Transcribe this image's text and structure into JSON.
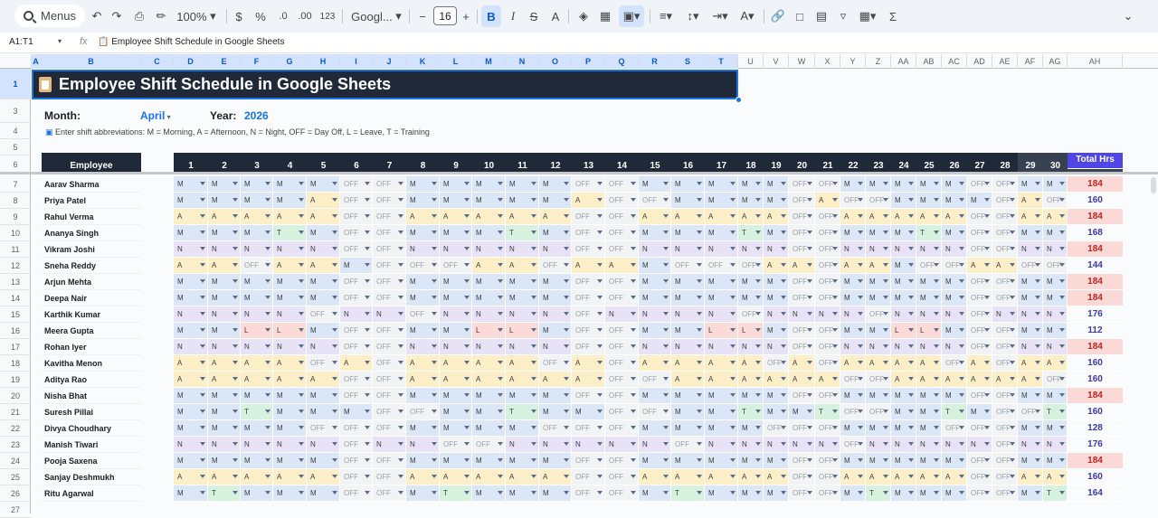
{
  "toolbar": {
    "menus_label": "Menus",
    "zoom": "100%",
    "currency": "$",
    "percent": "%",
    "dec_decrease": ".0",
    "dec_increase": ".00",
    "number_format": "123",
    "font": "Googl...",
    "font_size": "16",
    "bold": "B",
    "italic": "I",
    "strike": "S",
    "text_color": "A"
  },
  "formula_bar": {
    "name_box": "A1:T1",
    "fx": "fx",
    "content": "📋 Employee Shift Schedule in Google Sheets"
  },
  "columns": [
    "A",
    "B",
    "C",
    "D",
    "E",
    "F",
    "G",
    "H",
    "I",
    "J",
    "K",
    "L",
    "M",
    "N",
    "O",
    "P",
    "Q",
    "R",
    "S",
    "T",
    "U",
    "V",
    "W",
    "X",
    "Y",
    "Z",
    "AA",
    "AB",
    "AC",
    "AD",
    "AE",
    "AF",
    "AG",
    "AH"
  ],
  "rows": [
    "1",
    "3",
    "4",
    "5",
    "6",
    "7",
    "8",
    "9",
    "10",
    "11",
    "12",
    "13",
    "14",
    "15",
    "16",
    "17",
    "18",
    "19",
    "20",
    "21",
    "22",
    "23",
    "24",
    "25",
    "26",
    "27"
  ],
  "sheet": {
    "title": "Employee Shift Schedule in Google Sheets",
    "month_label": "Month:",
    "month_value": "April",
    "year_label": "Year:",
    "year_value": "2026",
    "note": "Enter shift abbreviations: M = Morning, A = Afternoon, N = Night, OFF = Day Off, L = Leave, T = Training"
  },
  "table": {
    "employee_header": "Employee",
    "days": [
      "1",
      "2",
      "3",
      "4",
      "5",
      "6",
      "7",
      "8",
      "9",
      "10",
      "11",
      "12",
      "13",
      "14",
      "15",
      "16",
      "17",
      "18",
      "19",
      "20",
      "21",
      "22",
      "23",
      "24",
      "25",
      "26",
      "27",
      "28",
      "29",
      "30",
      "31"
    ],
    "total_header": "Total Hrs",
    "employees": [
      {
        "name": "Aarav Sharma",
        "total": "184",
        "hi": true,
        "shifts": [
          "M",
          "M",
          "M",
          "M",
          "M",
          "OFF",
          "OFF",
          "M",
          "M",
          "M",
          "M",
          "M",
          "OFF",
          "OFF",
          "M",
          "M",
          "M",
          "M",
          "M",
          "OFF",
          "OFF",
          "M",
          "M",
          "M",
          "M",
          "M",
          "OFF",
          "OFF",
          "M",
          "M",
          "M"
        ]
      },
      {
        "name": "Priya Patel",
        "total": "160",
        "hi": false,
        "shifts": [
          "M",
          "M",
          "M",
          "M",
          "A",
          "OFF",
          "OFF",
          "M",
          "M",
          "M",
          "M",
          "M",
          "A",
          "OFF",
          "OFF",
          "M",
          "M",
          "M",
          "M",
          "OFF",
          "A",
          "OFF",
          "OFF",
          "M",
          "M",
          "M",
          "M",
          "OFF",
          "A",
          "OFF",
          "M"
        ]
      },
      {
        "name": "Rahul Verma",
        "total": "184",
        "hi": true,
        "shifts": [
          "A",
          "A",
          "A",
          "A",
          "A",
          "OFF",
          "OFF",
          "A",
          "A",
          "A",
          "A",
          "A",
          "OFF",
          "OFF",
          "A",
          "A",
          "A",
          "A",
          "A",
          "OFF",
          "OFF",
          "A",
          "A",
          "A",
          "A",
          "A",
          "OFF",
          "OFF",
          "A",
          "A",
          "A"
        ]
      },
      {
        "name": "Ananya Singh",
        "total": "168",
        "hi": false,
        "shifts": [
          "M",
          "M",
          "M",
          "T",
          "M",
          "OFF",
          "OFF",
          "M",
          "M",
          "M",
          "T",
          "M",
          "OFF",
          "OFF",
          "M",
          "M",
          "M",
          "T",
          "M",
          "OFF",
          "OFF",
          "M",
          "M",
          "M",
          "T",
          "M",
          "OFF",
          "OFF",
          "M",
          "M",
          "M"
        ]
      },
      {
        "name": "Vikram Joshi",
        "total": "184",
        "hi": true,
        "shifts": [
          "N",
          "N",
          "N",
          "N",
          "N",
          "OFF",
          "OFF",
          "N",
          "N",
          "N",
          "N",
          "N",
          "OFF",
          "OFF",
          "N",
          "N",
          "N",
          "N",
          "N",
          "OFF",
          "OFF",
          "N",
          "N",
          "N",
          "N",
          "N",
          "OFF",
          "OFF",
          "N",
          "N",
          "N"
        ]
      },
      {
        "name": "Sneha Reddy",
        "total": "144",
        "hi": false,
        "shifts": [
          "A",
          "A",
          "OFF",
          "A",
          "A",
          "M",
          "OFF",
          "OFF",
          "OFF",
          "A",
          "A",
          "OFF",
          "A",
          "A",
          "M",
          "OFF",
          "OFF",
          "OFF",
          "A",
          "A",
          "OFF",
          "A",
          "A",
          "M",
          "OFF",
          "OFF",
          "A",
          "A",
          "OFF",
          "OFF",
          "A"
        ]
      },
      {
        "name": "Arjun Mehta",
        "total": "184",
        "hi": true,
        "shifts": [
          "M",
          "M",
          "M",
          "M",
          "M",
          "OFF",
          "OFF",
          "M",
          "M",
          "M",
          "M",
          "M",
          "OFF",
          "OFF",
          "M",
          "M",
          "M",
          "M",
          "M",
          "OFF",
          "OFF",
          "M",
          "M",
          "M",
          "M",
          "M",
          "OFF",
          "OFF",
          "M",
          "M",
          "M"
        ]
      },
      {
        "name": "Deepa Nair",
        "total": "184",
        "hi": true,
        "shifts": [
          "M",
          "M",
          "M",
          "M",
          "M",
          "OFF",
          "OFF",
          "M",
          "M",
          "M",
          "M",
          "M",
          "OFF",
          "OFF",
          "M",
          "M",
          "M",
          "M",
          "M",
          "OFF",
          "OFF",
          "M",
          "M",
          "M",
          "M",
          "M",
          "OFF",
          "OFF",
          "M",
          "M",
          "M"
        ]
      },
      {
        "name": "Karthik Kumar",
        "total": "176",
        "hi": false,
        "shifts": [
          "N",
          "N",
          "N",
          "N",
          "OFF",
          "N",
          "N",
          "OFF",
          "N",
          "N",
          "N",
          "N",
          "OFF",
          "N",
          "N",
          "N",
          "N",
          "OFF",
          "N",
          "N",
          "N",
          "N",
          "OFF",
          "N",
          "N",
          "N",
          "OFF",
          "N",
          "N",
          "N",
          "N"
        ]
      },
      {
        "name": "Meera Gupta",
        "total": "112",
        "hi": false,
        "shifts": [
          "M",
          "M",
          "L",
          "L",
          "M",
          "OFF",
          "OFF",
          "M",
          "M",
          "L",
          "L",
          "M",
          "OFF",
          "OFF",
          "M",
          "M",
          "L",
          "L",
          "M",
          "OFF",
          "OFF",
          "M",
          "M",
          "L",
          "L",
          "M",
          "OFF",
          "OFF",
          "M",
          "M",
          "L"
        ]
      },
      {
        "name": "Rohan Iyer",
        "total": "184",
        "hi": true,
        "shifts": [
          "N",
          "N",
          "N",
          "N",
          "N",
          "OFF",
          "OFF",
          "N",
          "N",
          "N",
          "N",
          "N",
          "OFF",
          "OFF",
          "N",
          "N",
          "N",
          "N",
          "N",
          "OFF",
          "OFF",
          "N",
          "N",
          "N",
          "N",
          "N",
          "OFF",
          "OFF",
          "N",
          "N",
          "N"
        ]
      },
      {
        "name": "Kavitha Menon",
        "total": "160",
        "hi": false,
        "shifts": [
          "A",
          "A",
          "A",
          "A",
          "OFF",
          "A",
          "OFF",
          "A",
          "A",
          "A",
          "A",
          "OFF",
          "A",
          "OFF",
          "A",
          "A",
          "A",
          "A",
          "OFF",
          "A",
          "OFF",
          "A",
          "A",
          "A",
          "A",
          "OFF",
          "A",
          "OFF",
          "A",
          "A",
          "A"
        ]
      },
      {
        "name": "Aditya Rao",
        "total": "160",
        "hi": false,
        "shifts": [
          "A",
          "A",
          "A",
          "A",
          "A",
          "OFF",
          "OFF",
          "A",
          "A",
          "A",
          "A",
          "A",
          "A",
          "OFF",
          "OFF",
          "A",
          "A",
          "A",
          "A",
          "A",
          "A",
          "OFF",
          "OFF",
          "A",
          "A",
          "A",
          "A",
          "A",
          "A",
          "OFF",
          "OFF"
        ]
      },
      {
        "name": "Nisha Bhat",
        "total": "184",
        "hi": true,
        "shifts": [
          "M",
          "M",
          "M",
          "M",
          "M",
          "OFF",
          "OFF",
          "M",
          "M",
          "M",
          "M",
          "M",
          "OFF",
          "OFF",
          "M",
          "M",
          "M",
          "M",
          "M",
          "OFF",
          "OFF",
          "M",
          "M",
          "M",
          "M",
          "M",
          "OFF",
          "OFF",
          "M",
          "M",
          "M"
        ]
      },
      {
        "name": "Suresh Pillai",
        "total": "160",
        "hi": false,
        "shifts": [
          "M",
          "M",
          "T",
          "M",
          "M",
          "M",
          "OFF",
          "OFF",
          "M",
          "M",
          "T",
          "M",
          "M",
          "OFF",
          "OFF",
          "M",
          "M",
          "T",
          "M",
          "M",
          "T",
          "OFF",
          "OFF",
          "M",
          "M",
          "T",
          "M",
          "OFF",
          "OFF",
          "T",
          "M"
        ]
      },
      {
        "name": "Divya Choudhary",
        "total": "128",
        "hi": false,
        "shifts": [
          "M",
          "M",
          "M",
          "M",
          "OFF",
          "OFF",
          "OFF",
          "M",
          "M",
          "M",
          "M",
          "OFF",
          "OFF",
          "OFF",
          "M",
          "M",
          "M",
          "M",
          "OFF",
          "OFF",
          "OFF",
          "M",
          "M",
          "M",
          "M",
          "OFF",
          "OFF",
          "OFF",
          "M",
          "M",
          "M"
        ]
      },
      {
        "name": "Manish Tiwari",
        "total": "176",
        "hi": false,
        "shifts": [
          "N",
          "N",
          "N",
          "N",
          "N",
          "OFF",
          "N",
          "N",
          "OFF",
          "OFF",
          "N",
          "N",
          "N",
          "N",
          "N",
          "OFF",
          "N",
          "N",
          "N",
          "N",
          "N",
          "OFF",
          "N",
          "N",
          "N",
          "N",
          "N",
          "OFF",
          "N",
          "N",
          "N"
        ]
      },
      {
        "name": "Pooja Saxena",
        "total": "184",
        "hi": true,
        "shifts": [
          "M",
          "M",
          "M",
          "M",
          "M",
          "OFF",
          "OFF",
          "M",
          "M",
          "M",
          "M",
          "M",
          "OFF",
          "OFF",
          "M",
          "M",
          "M",
          "M",
          "M",
          "OFF",
          "OFF",
          "M",
          "M",
          "M",
          "M",
          "M",
          "OFF",
          "OFF",
          "M",
          "M",
          "M"
        ]
      },
      {
        "name": "Sanjay Deshmukh",
        "total": "160",
        "hi": false,
        "shifts": [
          "A",
          "A",
          "A",
          "A",
          "A",
          "OFF",
          "OFF",
          "A",
          "A",
          "A",
          "A",
          "A",
          "OFF",
          "OFF",
          "A",
          "A",
          "A",
          "A",
          "A",
          "OFF",
          "OFF",
          "A",
          "A",
          "A",
          "A",
          "A",
          "OFF",
          "OFF",
          "A",
          "A",
          "A"
        ]
      },
      {
        "name": "Ritu Agarwal",
        "total": "164",
        "hi": false,
        "shifts": [
          "M",
          "T",
          "M",
          "M",
          "M",
          "OFF",
          "OFF",
          "M",
          "T",
          "M",
          "M",
          "M",
          "OFF",
          "OFF",
          "M",
          "T",
          "M",
          "M",
          "M",
          "OFF",
          "OFF",
          "M",
          "T",
          "M",
          "M",
          "M",
          "OFF",
          "OFF",
          "M",
          "T",
          "M"
        ]
      }
    ]
  },
  "colors": {
    "M": "#dbe6f6",
    "A": "#fcefc7",
    "N": "#e7e2f6",
    "OFF": "#f1f3f4",
    "L": "#fbdad7",
    "T": "#d7f1df",
    "header_dark": "#1f2937",
    "total_header": "#4f46e5",
    "total_text": "#3d3aa8",
    "total_hi_bg": "#fbd9d6",
    "total_hi_text": "#c5221f"
  }
}
